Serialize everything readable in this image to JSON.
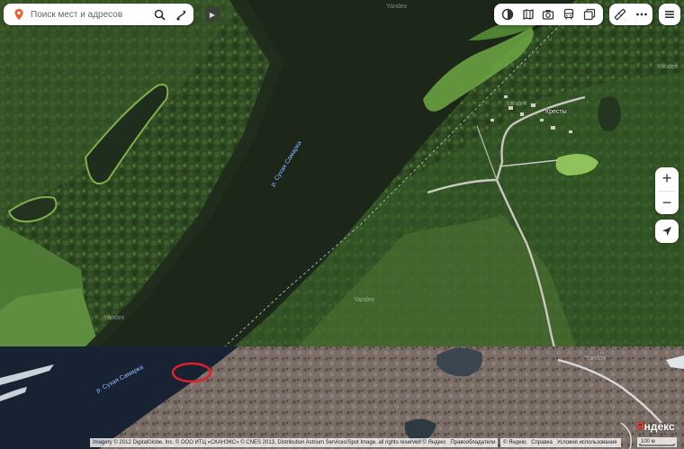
{
  "search": {
    "placeholder": "Поиск мест и адресов",
    "search_icon": "search-icon",
    "route_icon": "route-icon"
  },
  "toolbar": {
    "layers": [
      "map-layers-icon",
      "panorama-icon",
      "photo-icon",
      "transport-icon",
      "traffic-icon"
    ],
    "tools": [
      "ruler-icon",
      "more-icon"
    ],
    "menu": "menu-icon"
  },
  "zoom": {
    "in_label": "+",
    "out_label": "−"
  },
  "map": {
    "place_label": "Кресты",
    "river_label_upper": "р. Сухая Самарка",
    "river_label_lower": "р. Сухая Самарка",
    "watermark": "Yandex",
    "highlight_color": "#e0202a"
  },
  "attribution": {
    "text": "Imagery © 2012 DigitalGlobe, Inc. © ООО ИТЦ «СКАНЭКС» © CNES 2013, Distribution Astrium Services/Spot Image, all rights reserved © Яндекс",
    "rights_link": "Правообладатели"
  },
  "footer": {
    "copyright": "© Яндекс",
    "help": "Справка",
    "terms": "Условия использования",
    "scale_label": "100 м"
  },
  "logo": {
    "first_letter": "Я",
    "rest": "ндекс"
  }
}
